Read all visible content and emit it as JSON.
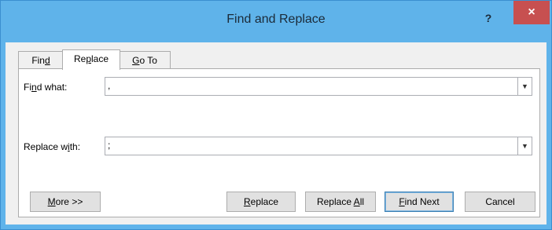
{
  "window": {
    "title": "Find and Replace",
    "help_label": "?",
    "close_label": "×"
  },
  "tabs": [
    {
      "pre": "Fin",
      "key": "d",
      "post": "",
      "active": false
    },
    {
      "pre": "Re",
      "key": "p",
      "post": "lace",
      "active": true
    },
    {
      "pre": "",
      "key": "G",
      "post": "o To",
      "active": false
    }
  ],
  "find": {
    "label_pre": "Fi",
    "label_key": "n",
    "label_post": "d what:",
    "value": ","
  },
  "replace": {
    "label_pre": "Replace w",
    "label_key": "i",
    "label_post": "th:",
    "value": ";"
  },
  "buttons": {
    "more": {
      "pre": "",
      "key": "M",
      "post": "ore >>"
    },
    "replace": {
      "pre": "",
      "key": "R",
      "post": "eplace"
    },
    "replace_all": {
      "pre": "Replace ",
      "key": "A",
      "post": "ll"
    },
    "find_next": {
      "pre": "",
      "key": "F",
      "post": "ind Next"
    },
    "cancel": {
      "label": "Cancel"
    }
  },
  "icons": {
    "dropdown": "chevron-down-icon"
  }
}
